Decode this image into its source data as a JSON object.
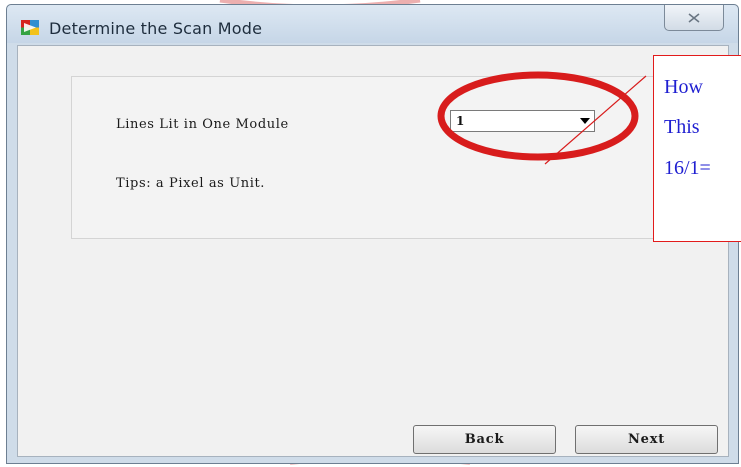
{
  "window": {
    "title": "Determine the Scan Mode",
    "close_glyph": "✕"
  },
  "form": {
    "lines_label": "Lines Lit in One Module",
    "lines_value": "1",
    "tips_label": "Tips: a Pixel as Unit."
  },
  "buttons": {
    "back_label": "Back",
    "next_label": "Next"
  },
  "annotation": {
    "line1": "How",
    "line2": "This",
    "line3": "16/1=",
    "border_color": "#e21b1b",
    "text_color": "#1f1fd1",
    "circle_color": "#d81c1c"
  },
  "icons": {
    "app": "app-icon",
    "close": "close-icon",
    "dropdown": "chevron-down-icon"
  }
}
